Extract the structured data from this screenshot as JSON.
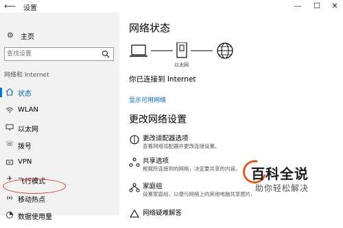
{
  "window": {
    "title": "设置",
    "back_glyph": "⟵",
    "minimize_glyph": "—",
    "maximize_glyph": "☐",
    "close_glyph": "✕"
  },
  "sidebar": {
    "home_label": "主页",
    "search_placeholder": "查找设置",
    "section_label": "网络和 Internet",
    "items": [
      {
        "label": "状态",
        "icon": "globe-icon",
        "glyph": "⌂"
      },
      {
        "label": "WLAN",
        "icon": "wifi-icon",
        "glyph": "≋"
      },
      {
        "label": "以太网",
        "icon": "ethernet-icon",
        "glyph": "▭"
      },
      {
        "label": "拨号",
        "icon": "dialup-icon",
        "glyph": "☏"
      },
      {
        "label": "VPN",
        "icon": "vpn-icon",
        "glyph": "⊡"
      },
      {
        "label": "飞行模式",
        "icon": "airplane-icon",
        "glyph": "✈"
      },
      {
        "label": "移动热点",
        "icon": "hotspot-icon",
        "glyph": "◉"
      },
      {
        "label": "数据使用量",
        "icon": "data-usage-icon",
        "glyph": "◔"
      }
    ]
  },
  "main": {
    "heading": "网络状态",
    "ethernet_label": "以太网",
    "connected_text": "你已连接到 Internet",
    "show_networks_link": "显示可用网络",
    "change_heading": "更改网络设置",
    "options": [
      {
        "title": "更改适配器选项",
        "desc": "查看网络适配器并更改连接设置。",
        "icon": "adapter-icon"
      },
      {
        "title": "共享选项",
        "desc": "根据所连接到的网络，决定要共享的内容。",
        "icon": "sharing-icon"
      },
      {
        "title": "家庭组",
        "desc": "设置家庭组，以便与网络上的其他电脑共享图片、",
        "icon": "homegroup-icon"
      },
      {
        "title": "网络疑难解答",
        "desc": "",
        "icon": "troubleshoot-icon"
      }
    ]
  },
  "watermark": {
    "line1": "百科全说",
    "line2": "助你轻松解决"
  },
  "colors": {
    "accent": "#0078d7",
    "link": "#0063b1",
    "sidebar_bg": "#f2f2f2",
    "highlight_circle": "#e03030"
  }
}
